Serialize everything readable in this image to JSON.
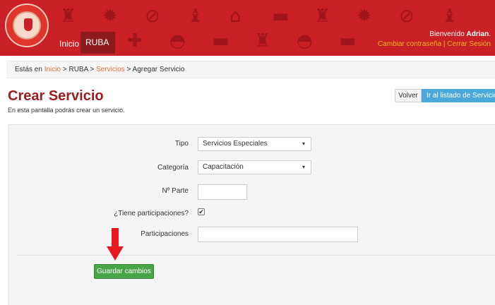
{
  "header": {
    "nav_home": "Inicio",
    "nav_ruba": "RUBA",
    "nav_ruba_caret": "▾",
    "welcome_prefix": "Bienvenido ",
    "welcome_user": "Adrian",
    "welcome_suffix": ".",
    "change_password": "Cambiar contraseña",
    "separator": "|",
    "logout": "Cerrar Sesión",
    "brand_color": "#c82026",
    "pattern_icons": [
      "fire-hydrant-icon",
      "fire-icon",
      "no-smoking-icon",
      "extinguisher-icon",
      "house-fire-icon",
      "ambulance-icon",
      "fire-truck-icon",
      "first-aid-icon",
      "helmet-icon"
    ]
  },
  "breadcrumb": {
    "prefix": "Estás en ",
    "home": "Inicio",
    "sep1": " > ",
    "ruba": "RUBA",
    "sep2": " > ",
    "services": "Servicios",
    "sep3": " > ",
    "current": "Agregar Servicio"
  },
  "page": {
    "title": "Crear Servicio",
    "subtitle": "En esta pantalla podrás crear un servicio."
  },
  "actions": {
    "back": "Volver",
    "list": "Ir al listado de Servicios"
  },
  "form": {
    "tipo_label": "Tipo",
    "tipo_value": "Servicios Especiales",
    "categoria_label": "Categoría",
    "categoria_value": "Capacitación",
    "parte_label": "Nº Parte",
    "parte_value": "",
    "participaciones_q_label": "¿Tiene participaciones?",
    "participaciones_checked": true,
    "participaciones_label": "Participaciones",
    "participaciones_value": "",
    "select_caret": "▾",
    "check_mark": "✔",
    "save": "Guardar cambios"
  },
  "colors": {
    "title": "#9d1c1d",
    "link": "#e8703a",
    "primary_button": "#4aa9d8",
    "save_button": "#47a447",
    "highlight_arrow": "#e8191e"
  }
}
